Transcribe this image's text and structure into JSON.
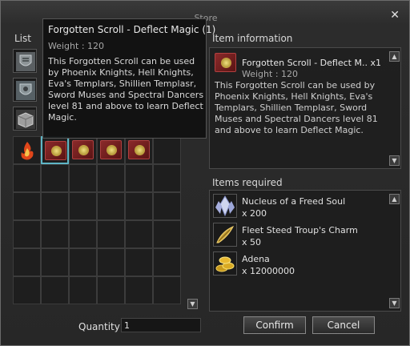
{
  "window": {
    "title": "Store",
    "close_label": "✕"
  },
  "list": {
    "label": "List",
    "categories": [
      {
        "icon": "shield-scroll-icon"
      },
      {
        "icon": "shield-scroll-icon"
      },
      {
        "icon": "stone-block-icon"
      }
    ],
    "tabs": [
      {
        "icon": "fire-icon"
      },
      {
        "icon": "red-book-icon",
        "selected": true
      },
      {
        "icon": "red-book-icon"
      },
      {
        "icon": "red-book-icon"
      },
      {
        "icon": "red-book-icon"
      }
    ],
    "scroll_down": "▼"
  },
  "tooltip": {
    "title": "Forgotten Scroll - Deflect Magic (1)",
    "weight": "Weight : 120",
    "description": "This Forgotten Scroll can be used by Phoenix Knights, Hell Knights, Eva's Templars, Shillien Templasr, Sword Muses and Spectral Dancers level 81 and above to learn Deflect Magic."
  },
  "item_info": {
    "label": "Item information",
    "name": "Forgotten Scroll - Deflect M.. x1",
    "weight": "Weight : 120",
    "description": "This Forgotten Scroll can be used by Phoenix Knights, Hell Knights, Eva's Templars, Shillien Templasr, Sword Muses and Spectral Dancers level 81 and above to learn Deflect Magic.",
    "scroll_up": "▲",
    "scroll_down": "▼"
  },
  "items_required": {
    "label": "Items required",
    "items": [
      {
        "name": "Nucleus of a Freed Soul",
        "quantity": "x 200",
        "icon": "crystal-icon"
      },
      {
        "name": "Fleet Steed Troup's Charm",
        "quantity": "x 50",
        "icon": "feather-charm-icon"
      },
      {
        "name": "Adena",
        "quantity": "x 12000000",
        "icon": "gold-coins-icon"
      }
    ],
    "scroll_up": "▲",
    "scroll_down": "▼"
  },
  "footer": {
    "quantity_label": "Quantity",
    "quantity_value": "1",
    "confirm_label": "Confirm",
    "cancel_label": "Cancel"
  }
}
